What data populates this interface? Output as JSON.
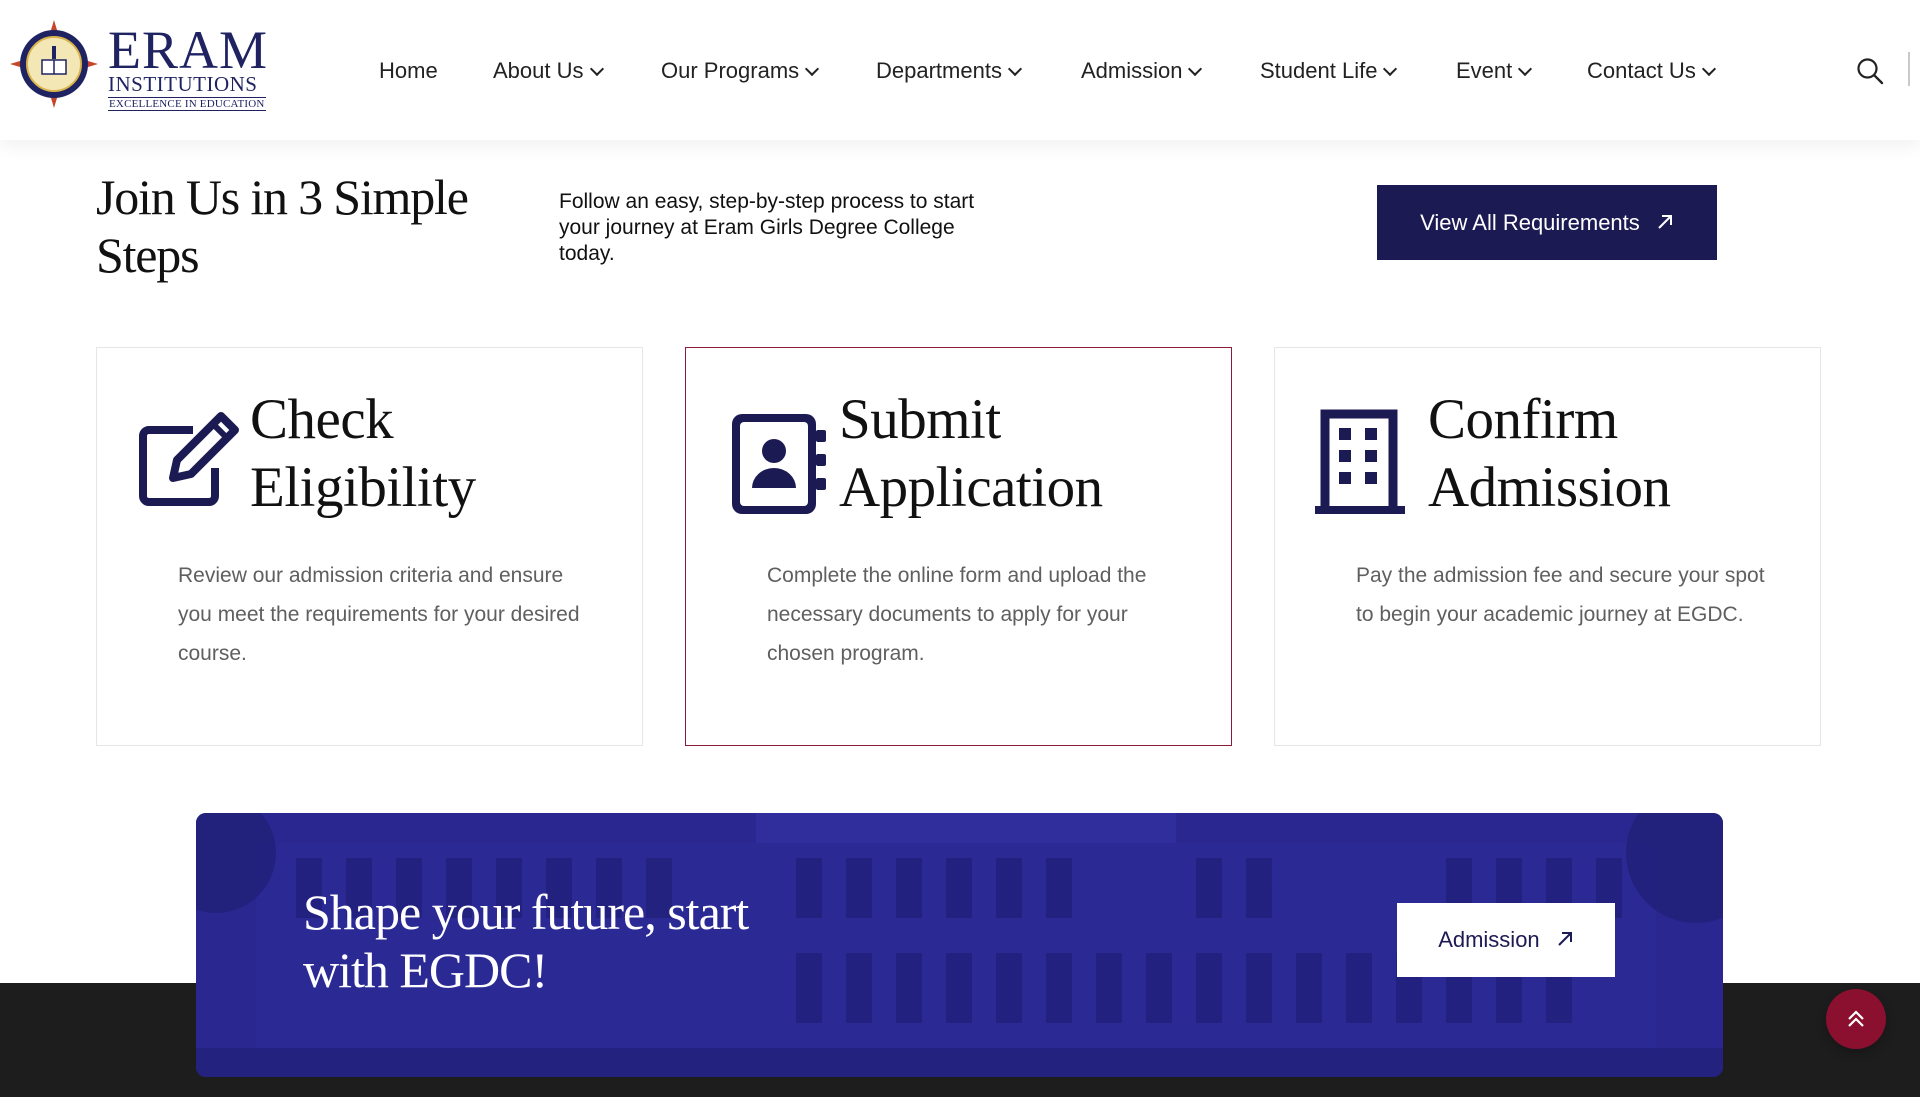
{
  "logo": {
    "main": "ERAM",
    "sub": "INSTITUTIONS",
    "tag": "EXCELLENCE IN EDUCATION"
  },
  "nav": {
    "items": [
      {
        "label": "Home",
        "dropdown": false
      },
      {
        "label": "About Us",
        "dropdown": true
      },
      {
        "label": "Our Programs",
        "dropdown": true
      },
      {
        "label": "Departments",
        "dropdown": true
      },
      {
        "label": "Admission",
        "dropdown": true
      },
      {
        "label": "Student Life",
        "dropdown": true
      },
      {
        "label": "Event",
        "dropdown": true
      },
      {
        "label": "Contact Us",
        "dropdown": true
      }
    ],
    "search_icon": "search-icon"
  },
  "steps": {
    "title": "Join Us in 3 Simple Steps",
    "description": "Follow an easy, step-by-step process to start your journey at Eram Girls Degree College today.",
    "button_label": "View All Requirements",
    "cards": [
      {
        "title": "Check Eligibility",
        "text": "Review our admission criteria and ensure you meet the requirements for your desired course.",
        "icon": "edit-icon"
      },
      {
        "title": "Submit Application",
        "text": "Complete the online form and upload the necessary documents to apply for your chosen program.",
        "icon": "contact-book-icon"
      },
      {
        "title": "Confirm Admission",
        "text": "Pay the admission fee and secure your spot to begin your academic journey at EGDC.",
        "icon": "building-icon"
      }
    ]
  },
  "cta": {
    "title": "Shape your future, start with EGDC!",
    "button_label": "Admission"
  },
  "colors": {
    "primary": "#1c1a52",
    "accent": "#8b1c3a",
    "cta_overlay": "#24218a",
    "footer": "#1d1d1d"
  }
}
